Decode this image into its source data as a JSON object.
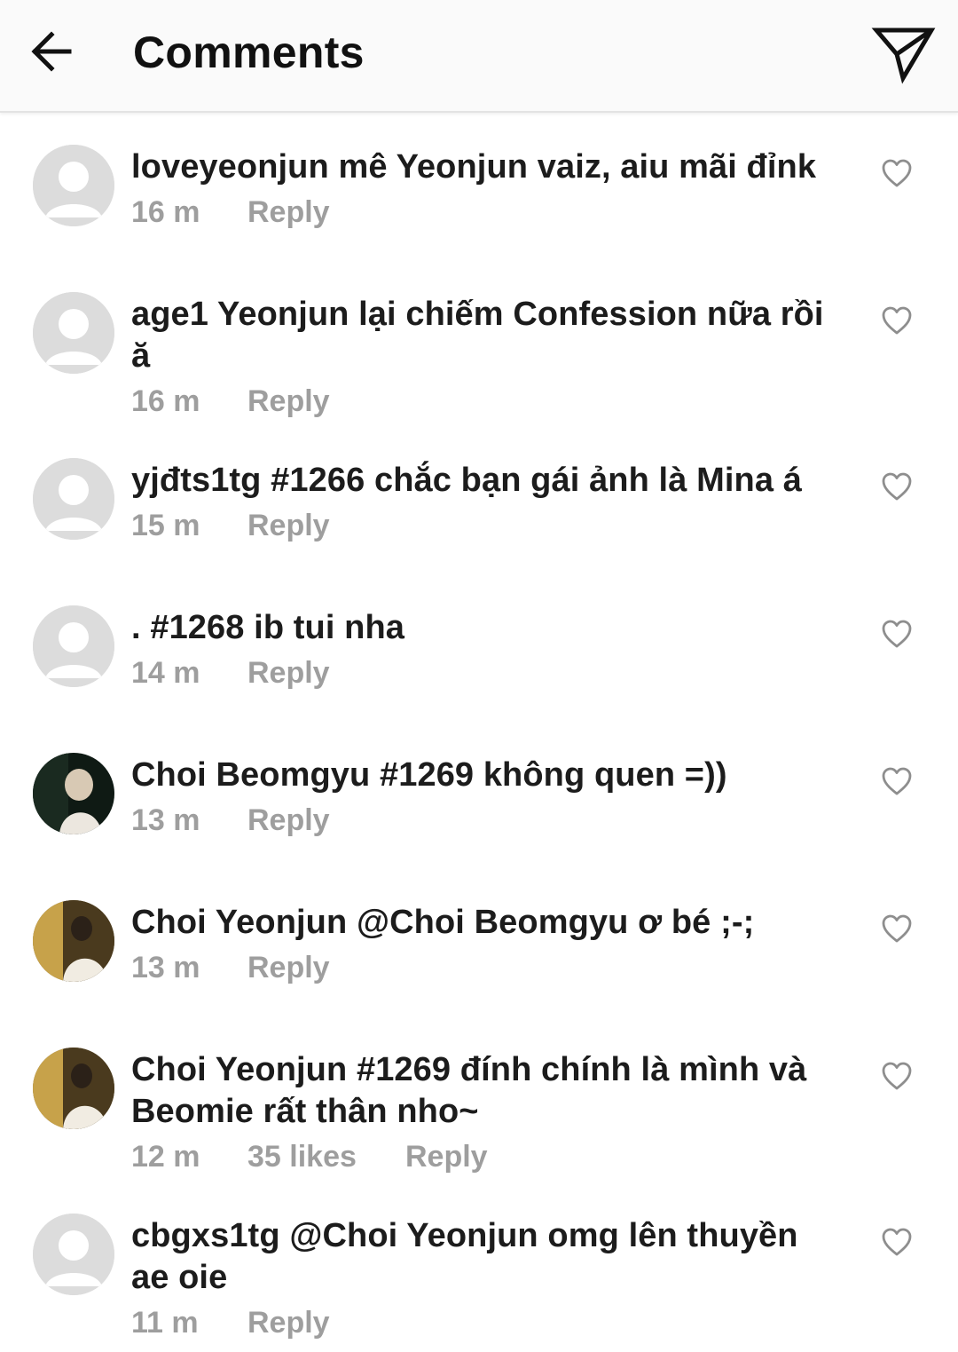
{
  "header": {
    "title": "Comments",
    "back_icon": "arrow-left-icon",
    "send_icon": "paper-plane-icon"
  },
  "comments": [
    {
      "username": "loveyeonjun",
      "text": "mê Yeonjun vaiz, aiu mãi đỉnk",
      "time": "16 m",
      "likes": "",
      "reply": "Reply",
      "avatar": "default"
    },
    {
      "username": "age1",
      "text": "Yeonjun lại chiếm Confession nữa rồi ă",
      "time": "16 m",
      "likes": "",
      "reply": "Reply",
      "avatar": "default"
    },
    {
      "username": "yjđts1tg",
      "text": "#1266 chắc bạn gái ảnh là Mina á",
      "time": "15 m",
      "likes": "",
      "reply": "Reply",
      "avatar": "default"
    },
    {
      "username": ".",
      "text": "#1268 ib tui nha",
      "time": "14 m",
      "likes": "",
      "reply": "Reply",
      "avatar": "default"
    },
    {
      "username": "Choi Beomgyu",
      "text": "#1269 không quen =))",
      "time": "13 m",
      "likes": "",
      "reply": "Reply",
      "avatar": "photo-dark"
    },
    {
      "username": "Choi Yeonjun",
      "text": "@Choi Beomgyu ơ bé ;-;",
      "time": "13 m",
      "likes": "",
      "reply": "Reply",
      "avatar": "photo-warm"
    },
    {
      "username": "Choi Yeonjun",
      "text": "#1269 đính chính là mình và Beomie rất thân nho~",
      "time": "12 m",
      "likes": "35 likes",
      "reply": "Reply",
      "avatar": "photo-warm"
    },
    {
      "username": "cbgxs1tg",
      "text": "@Choi Yeonjun omg lên thuyền ae oie",
      "time": "11 m",
      "likes": "",
      "reply": "Reply",
      "avatar": "default"
    }
  ],
  "colors": {
    "text": "#1c1c1c",
    "meta": "#9e9e9e",
    "avatar_default": "#dcdcdc",
    "header_bg": "#fafafa"
  }
}
